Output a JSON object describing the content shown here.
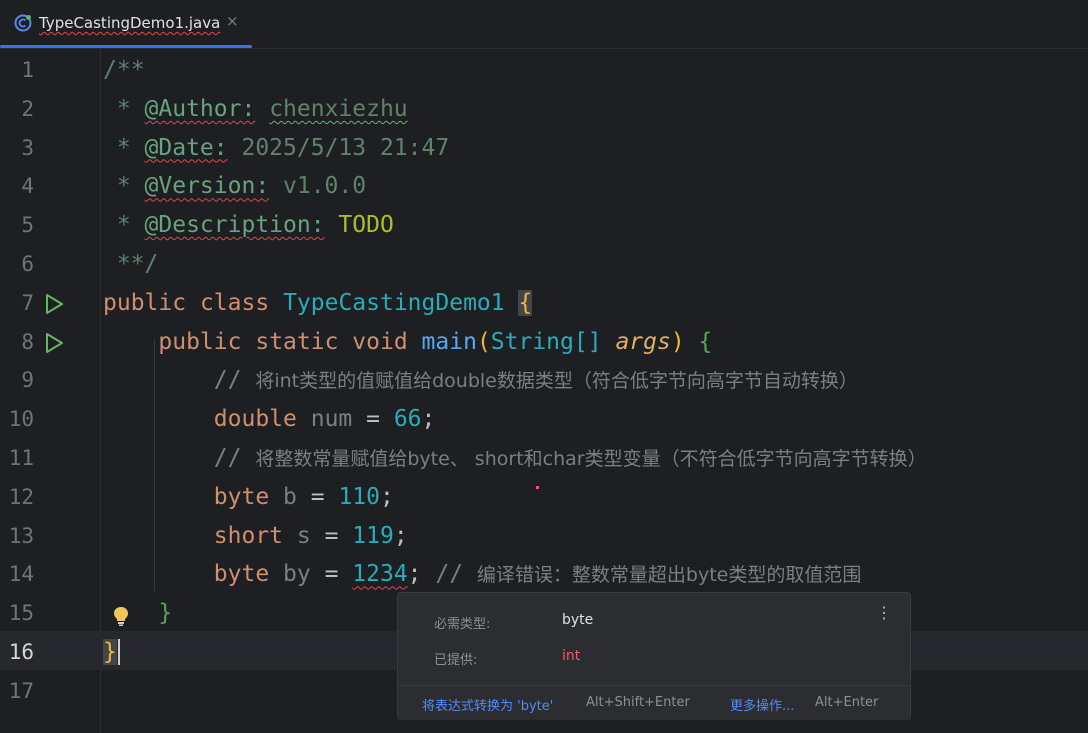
{
  "tab": {
    "file_name": "TypeCastingDemo1.java",
    "close": "×"
  },
  "lines": [
    "1",
    "2",
    "3",
    "4",
    "5",
    "6",
    "7",
    "8",
    "9",
    "10",
    "11",
    "12",
    "13",
    "14",
    "15",
    "16",
    "17"
  ],
  "active_line": "16",
  "code": {
    "l1": "/**",
    "l2_star": " * ",
    "l2_tag": "@Author:",
    "l2_val": " chenxiezhu",
    "l3_star": " * ",
    "l3_tag": "@Date:",
    "l3_val": " 2025/5/13 21:47",
    "l4_star": " * ",
    "l4_tag": "@Version:",
    "l4_val": " v1.0.0",
    "l5_star": " * ",
    "l5_tag": "@Description:",
    "l5_val": " TODO",
    "l6": " **/",
    "l7_public": "public",
    "l7_class": "class",
    "l7_name": "TypeCastingDemo1",
    "l7_brace": "{",
    "l8_public": "public",
    "l8_static": "static",
    "l8_void": "void",
    "l8_main": "main",
    "l8_open": "(",
    "l8_type": "String[]",
    "l8_param": "args",
    "l8_close": ")",
    "l8_brace": "{",
    "l9_cmt_slash": "// ",
    "l9_cmt": "将int类型的值赋值给double数据类型（符合低字节向高字节自动转换）",
    "l10_type": "double",
    "l10_var": "num",
    "l10_eq": " = ",
    "l10_num": "66",
    "l10_semi": ";",
    "l11_cmt_slash": "// ",
    "l11_cmt": "将整数常量赋值给byte、 short和char类型变量（不符合低字节向高字节转换）",
    "l12_type": "byte",
    "l12_var": "b",
    "l12_eq": " = ",
    "l12_num": "110",
    "l12_semi": ";",
    "l13_type": "short",
    "l13_var": "s",
    "l13_eq": " = ",
    "l13_num": "119",
    "l13_semi": ";",
    "l14_type": "byte",
    "l14_var": "by",
    "l14_eq": " = ",
    "l14_num": "1234",
    "l14_semi": ";",
    "l14_cmt_slash": " // ",
    "l14_cmt": "编译错误：整数常量超出byte类型的取值范围",
    "l15_brace": "}",
    "l16_brace": "}"
  },
  "popup": {
    "required_label": "必需类型:",
    "required_value": "byte",
    "provided_label": "已提供:",
    "provided_value": "int",
    "more_icon": "⋮",
    "fix_action": "将表达式转换为 'byte'",
    "fix_shortcut": "Alt+Shift+Enter",
    "more_actions": "更多操作...",
    "more_shortcut": "Alt+Enter"
  },
  "colors": {
    "error": "#e0474c",
    "accent": "#3574f0",
    "int_red": "#f75464"
  }
}
